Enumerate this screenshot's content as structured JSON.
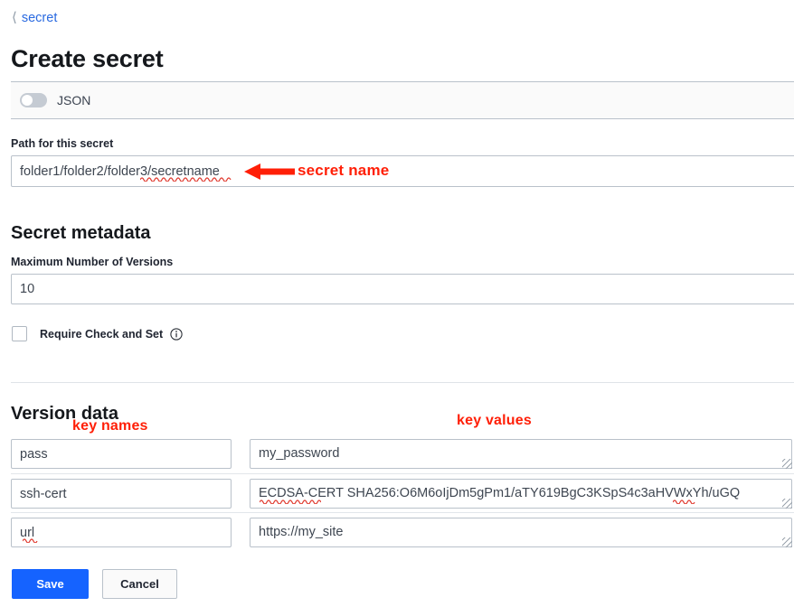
{
  "breadcrumb": {
    "back_icon": "chevron-left-icon",
    "label": "secret"
  },
  "page_title": "Create secret",
  "json_toggle": {
    "label": "JSON",
    "state": "off"
  },
  "path_section": {
    "label": "Path for this secret",
    "value": "folder1/folder2/folder3/secretname",
    "placeholder": ""
  },
  "secret_metadata": {
    "heading": "Secret metadata",
    "max_versions_label": "Maximum Number of Versions",
    "max_versions_value": "10",
    "require_cas_label": "Require Check and Set",
    "require_cas_checked": false,
    "info_icon": "info-circle-icon"
  },
  "version_data": {
    "heading": "Version data",
    "rows": [
      {
        "key": "pass",
        "value": "my_password"
      },
      {
        "key": "ssh-cert",
        "value": "ECDSA-CERT SHA256:O6M6oIjDm5gPm1/aTY619BgC3KSpS4c3aHVWxYh/uGQ"
      },
      {
        "key": "url",
        "value": "https://my_site"
      }
    ]
  },
  "buttons": {
    "save": "Save",
    "cancel": "Cancel"
  },
  "annotations": {
    "secret_name": "secret name",
    "key_names": "key names",
    "key_values": "key values",
    "arrow_icon": "left-arrow-icon"
  },
  "colors": {
    "accent_blue": "#1563ff",
    "link_blue": "#2a6ae0",
    "annotation_red": "#ff1f07",
    "panel_grey": "#fafafa",
    "border_grey": "#b9c1ca"
  }
}
